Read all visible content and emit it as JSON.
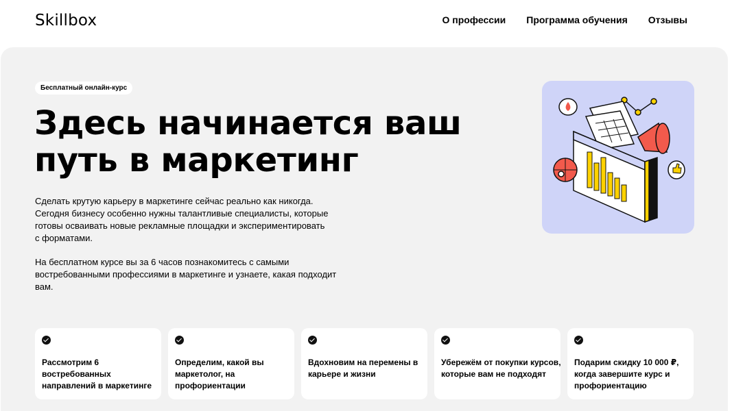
{
  "header": {
    "logo": "Skillbox",
    "nav": [
      "О профессии",
      "Программа обучения",
      "Отзывы"
    ]
  },
  "hero": {
    "badge": "Бесплатный онлайн-курс",
    "title_lines": [
      "Здесь начинается ваш",
      "путь в маркетинг"
    ],
    "paragraph1_lines": [
      "Сделать крутую карьеру в маркетинге сейчас    реально как никогда.",
      "Сегодня бизнесу особенно нужны талантливые специалисты, которые",
      "готовы осваивать новые рекламные площадки и экспериментировать",
      "с форматами."
    ],
    "paragraph2_lines": [
      "На бесплатном курсе вы за 6 часов познакомитесь с самыми",
      "востребованными профессиями в маркетинге и узнаете, какая подходит",
      "вам."
    ]
  },
  "cards": [
    {
      "lines": [
        "Рассмотрим 6",
        "востребованных",
        "направлений в маркетинге"
      ]
    },
    {
      "lines": [
        "Определим, какой вы",
        "маркетолог, на",
        "профориентации"
      ]
    },
    {
      "lines": [
        "Вдохновим на перемены в",
        "карьере и жизни"
      ]
    },
    {
      "lines": [
        "Убережём от покупки курсов,",
        "которые вам не подходят"
      ]
    },
    {
      "lines": [
        "Подарим скидку 10 000 ₽,",
        "когда завершите курс и",
        "профориентацию"
      ]
    }
  ],
  "colors": {
    "hero_bg": "#f2f2f2",
    "illustration_bg": "#cfd4f8",
    "accent_red": "#f25a4c",
    "accent_yellow": "#ffd200"
  }
}
